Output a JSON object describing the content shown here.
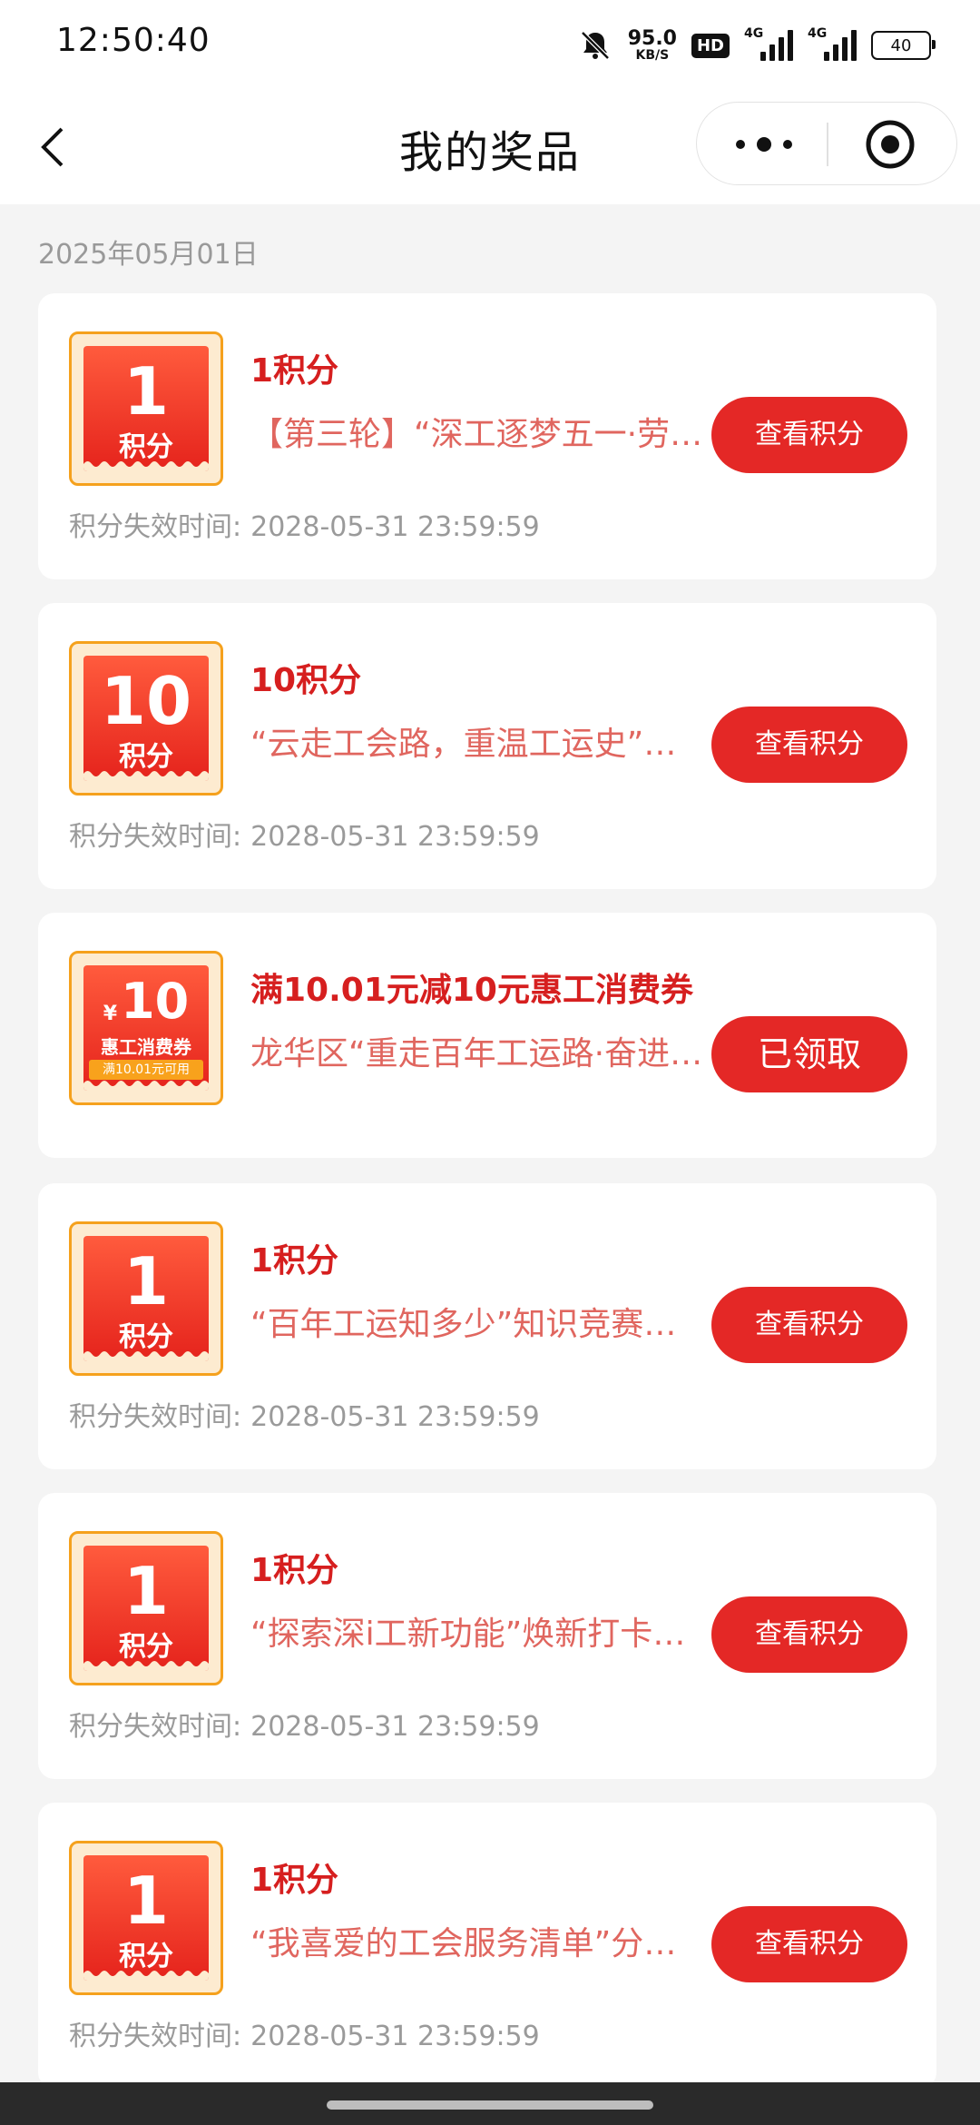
{
  "status_bar": {
    "time": "12:50:40",
    "net_speed": "95.0",
    "net_speed_unit": "KB/S",
    "hd_label": "HD",
    "signal1_label": "4G",
    "signal2_label": "4G",
    "battery": "40",
    "icons": [
      "bell-muted-icon",
      "signal-icon",
      "battery-icon"
    ]
  },
  "nav": {
    "title": "我的奖品",
    "icons": [
      "back-icon",
      "more-dots-icon",
      "target-icon"
    ]
  },
  "date_header": "2025年05月01日",
  "colors": {
    "accent_red": "#e42826",
    "title_red": "#d61f1f",
    "desc_red": "#e0665f",
    "badge_border": "#f5a11d"
  },
  "prizes": [
    {
      "badge_num": "1",
      "badge_unit": "积分",
      "title": "1积分",
      "desc": "【第三轮】“深工逐梦五一·劳动最光荣”",
      "button": "查看积分",
      "expiry_label": "积分失效时间:",
      "expiry_time": "2028-05-31 23:59:59"
    },
    {
      "badge_num": "10",
      "badge_unit": "积分",
      "title": "10积分",
      "desc": "“云走工会路，重温工运史”活动",
      "button": "查看积分",
      "expiry_label": "积分失效时间:",
      "expiry_time": "2028-05-31 23:59:59"
    },
    {
      "coupon": {
        "currency": "¥",
        "amount": "10",
        "name": "惠工消费券",
        "condition": "满10.01元可用"
      },
      "title": "满10.01元减10元惠工消费券",
      "desc": "龙华区“重走百年工运路·奋进新时代”",
      "button": "已领取"
    },
    {
      "badge_num": "1",
      "badge_unit": "积分",
      "title": "1积分",
      "desc": "“百年工运知多少”知识竞赛活动",
      "button": "查看积分",
      "expiry_label": "积分失效时间:",
      "expiry_time": "2028-05-31 23:59:59"
    },
    {
      "badge_num": "1",
      "badge_unit": "积分",
      "title": "1积分",
      "desc": "“探索深i工新功能”焕新打卡活动",
      "button": "查看积分",
      "expiry_label": "积分失效时间:",
      "expiry_time": "2028-05-31 23:59:59"
    },
    {
      "badge_num": "1",
      "badge_unit": "积分",
      "title": "1积分",
      "desc": "“我喜爱的工会服务清单”分享活动",
      "button": "查看积分",
      "expiry_label": "积分失效时间:",
      "expiry_time": "2028-05-31 23:59:59"
    }
  ]
}
